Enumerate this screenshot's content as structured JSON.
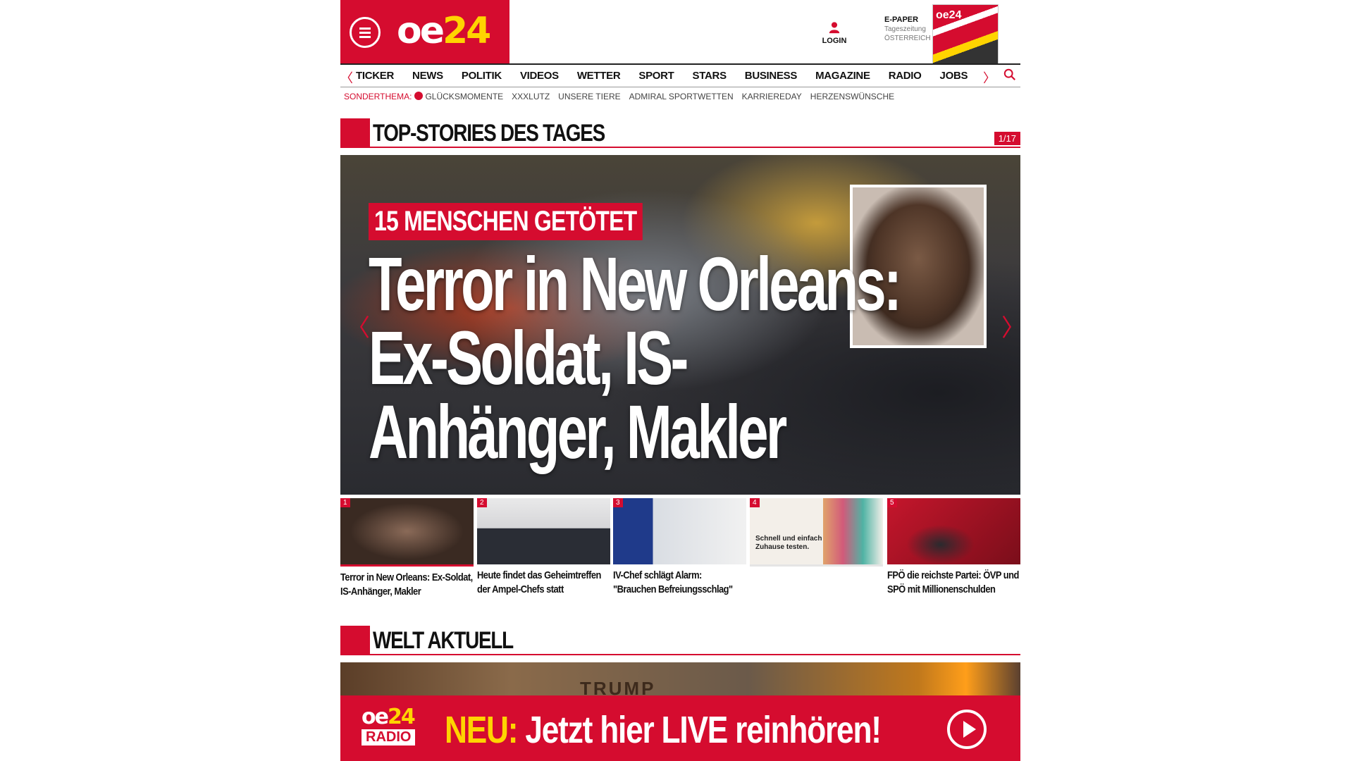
{
  "header": {
    "logo_text": "oe",
    "logo_num": "24",
    "login_label": "LOGIN",
    "epaper_title": "E-PAPER",
    "epaper_sub1": "Tageszeitung",
    "epaper_sub2": "ÖSTERREICH",
    "epaper_cover_text": "oe24"
  },
  "nav": {
    "items": [
      "TICKER",
      "NEWS",
      "POLITIK",
      "VIDEOS",
      "WETTER",
      "SPORT",
      "STARS",
      "BUSINESS",
      "MAGAZINE",
      "RADIO",
      "JOBS"
    ],
    "prev_arrow": "〈",
    "next_arrow": "〉"
  },
  "subnav": {
    "lead": "SONDERTHEMA:",
    "items": [
      "GLÜCKSMOMENTE",
      "XXXLUTZ",
      "UNSERE TIERE",
      "ADMIRAL SPORTWETTEN",
      "KARRIEREDAY",
      "HERZENSWÜNSCHE"
    ]
  },
  "top_stories": {
    "title": "TOP-STORIES DES TAGES",
    "pager": "1/17",
    "hero": {
      "kicker": "15 MENSCHEN GETÖTET",
      "headline": "Terror in New Orleans: Ex-Soldat, IS-Anhänger, Makler"
    },
    "thumbs": [
      {
        "num": "1",
        "caption": "Terror in New Orleans: Ex-Soldat, IS-Anhänger, Makler",
        "color1": "#8a6a58",
        "color2": "#3a2a22"
      },
      {
        "num": "2",
        "caption": "Heute findet das Geheimtreffen der Ampel-Chefs statt",
        "color1": "#e9e9ea",
        "color2": "#2a2d35"
      },
      {
        "num": "3",
        "caption": "IV-Chef schlägt Alarm: \"Brauchen Befreiungsschlag\"",
        "color1": "#1f3a8a",
        "color2": "#f1f1f1"
      },
      {
        "num": "4",
        "caption": "",
        "color1": "#f3efe9",
        "color2": "#e0a36b",
        "ad_text": "Schnell und einfach Zuhause testen."
      },
      {
        "num": "5",
        "caption": "FPÖ die reichste Partei: ÖVP und SPÖ mit Millionenschulden",
        "color1": "#c5162c",
        "color2": "#7a0e1a"
      }
    ]
  },
  "welt": {
    "title": "WELT AKTUELL",
    "image_text": "TRUMP"
  },
  "radio_banner": {
    "logo_text": "oe",
    "logo_num": "24",
    "logo_sub": "RADIO",
    "neu": "NEU:",
    "text": " Jetzt hier LIVE reinhören!"
  },
  "colors": {
    "brand_red": "#d50c2f",
    "accent_yellow": "#ffd400"
  }
}
